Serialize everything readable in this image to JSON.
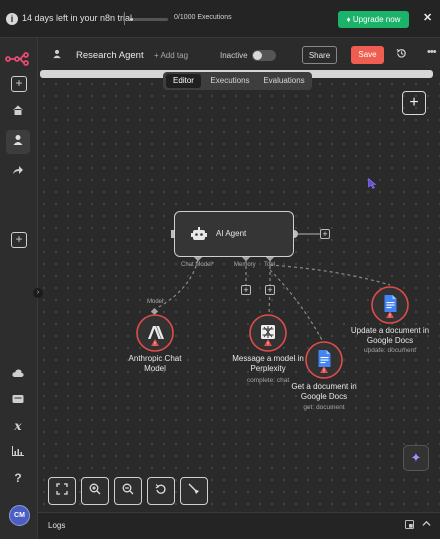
{
  "banner": {
    "trial_text": "14 days left in your n8n trial",
    "executions_text": "0/1000 Executions",
    "executions_used": 0,
    "executions_limit": 1000,
    "upgrade_label": "Upgrade now",
    "upgrade_color": "#1bb36a",
    "close_icon": "✕"
  },
  "sidebar": {
    "logo_color": "#ea4b71",
    "items": [
      {
        "name": "add-icon",
        "glyph": "+"
      },
      {
        "name": "home-icon",
        "glyph": "⌂"
      },
      {
        "name": "personal-icon",
        "glyph": "👤"
      },
      {
        "name": "shared-icon",
        "glyph": "↪"
      },
      {
        "name": "add-project-icon",
        "glyph": "+"
      },
      {
        "name": "cloud-icon",
        "glyph": "☁"
      },
      {
        "name": "templates-icon",
        "glyph": "▤"
      },
      {
        "name": "variables-icon",
        "glyph": "𝑥"
      },
      {
        "name": "insights-icon",
        "glyph": "▥"
      },
      {
        "name": "help-icon",
        "glyph": "?"
      }
    ],
    "avatar_initials": "CM"
  },
  "header": {
    "title": "Research Agent",
    "add_tag": "+ Add tag",
    "status": "Inactive",
    "share_label": "Share",
    "save_label": "Save",
    "save_color": "#ef5e50",
    "more_icon": "•••"
  },
  "tabs": [
    {
      "label": "Editor",
      "active": true
    },
    {
      "label": "Executions",
      "active": false
    },
    {
      "label": "Evaluations",
      "active": false
    }
  ],
  "canvas": {
    "add_node_icon": "+",
    "agent": {
      "label": "AI Agent"
    },
    "handles": {
      "chat_model": "Chat Model*",
      "memory": "Memory",
      "tool": "Tool",
      "model": "Model"
    },
    "nodes": [
      {
        "label": "Anthropic Chat Model",
        "sub": ""
      },
      {
        "label": "Message a model in Perplexity",
        "sub": "complete: chat"
      },
      {
        "label": "Get a document in Google Docs",
        "sub": "get: document"
      },
      {
        "label": "Update a document in Google Docs",
        "sub": "update: document"
      }
    ],
    "warning_color": "#e04b4b"
  },
  "controls": [
    "fit-view-icon",
    "zoom-in-icon",
    "zoom-out-icon",
    "reset-zoom-icon",
    "tidy-up-icon"
  ],
  "logs": {
    "label": "Logs"
  }
}
